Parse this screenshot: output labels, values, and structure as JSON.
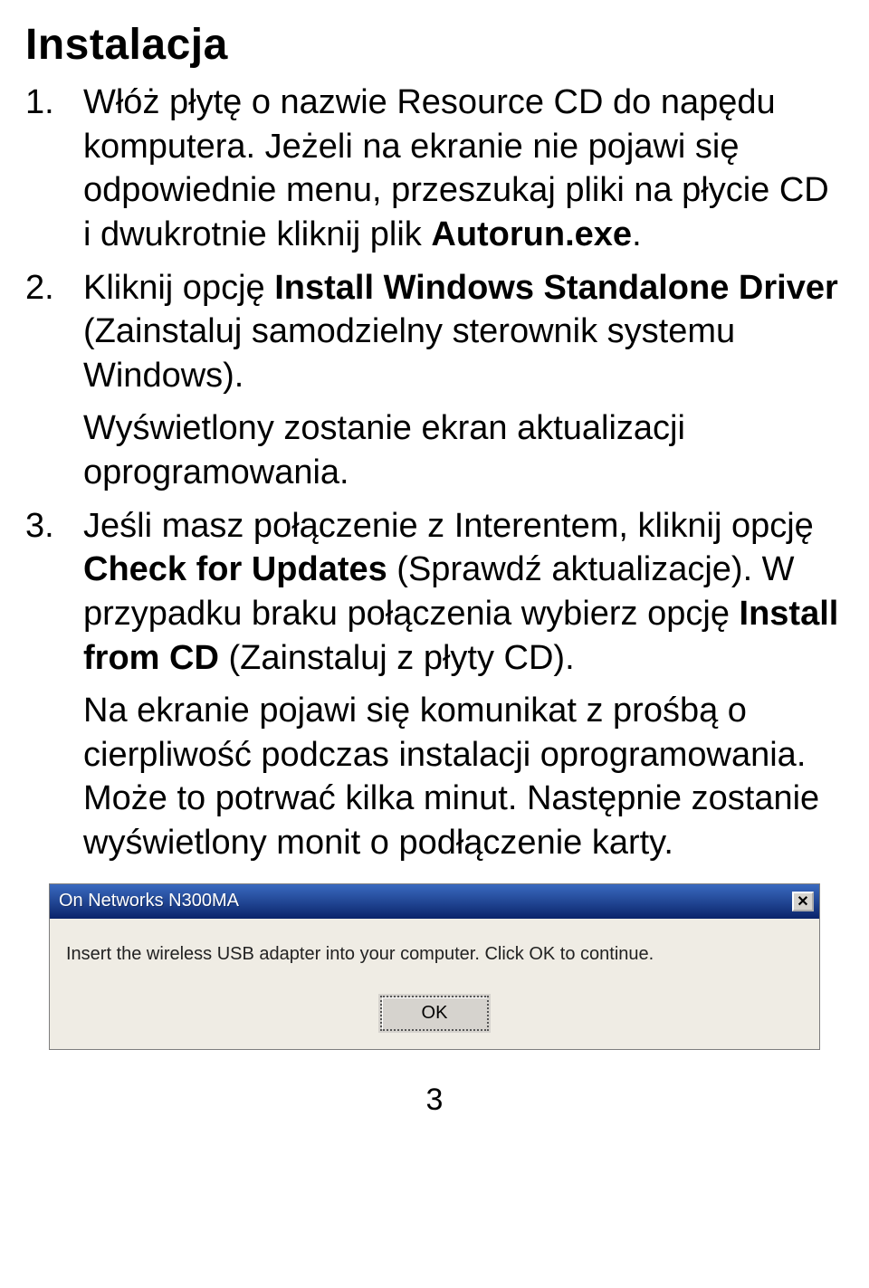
{
  "heading": "Instalacja",
  "steps": [
    {
      "num": "1.",
      "paragraphs": [
        {
          "segments": [
            {
              "text": "Włóż płytę o nazwie Resource CD do napędu komputera. Jeżeli na ekranie nie pojawi się odpowiednie menu, przeszukaj pliki na płycie CD i dwukrotnie kliknij plik "
            },
            {
              "text": "Autorun.exe",
              "bold": true
            },
            {
              "text": "."
            }
          ]
        }
      ]
    },
    {
      "num": "2.",
      "paragraphs": [
        {
          "segments": [
            {
              "text": "Kliknij opcję "
            },
            {
              "text": "Install Windows Standalone Driver",
              "bold": true
            },
            {
              "text": " (Zainstaluj samodzielny sterownik systemu Windows)."
            }
          ]
        },
        {
          "segments": [
            {
              "text": "Wyświetlony zostanie ekran aktualizacji oprogramowania."
            }
          ]
        }
      ]
    },
    {
      "num": "3.",
      "paragraphs": [
        {
          "segments": [
            {
              "text": "Jeśli masz połączenie z Interentem, kliknij opcję "
            },
            {
              "text": "Check for Updates",
              "bold": true
            },
            {
              "text": " (Sprawdź aktualizacje). W przypadku braku połączenia wybierz opcję "
            },
            {
              "text": "Install from CD",
              "bold": true
            },
            {
              "text": " (Zainstaluj z płyty CD)."
            }
          ]
        },
        {
          "segments": [
            {
              "text": "Na ekranie pojawi się komunikat z prośbą o cierpliwość podczas instalacji oprogramowania. Może to potrwać kilka minut. Następnie zostanie wyświetlony monit o podłączenie karty."
            }
          ]
        }
      ]
    }
  ],
  "dialog": {
    "title": "On Networks N300MA",
    "body": "Insert the wireless USB adapter into your computer. Click OK to continue.",
    "ok": "OK",
    "close": "✕"
  },
  "pageNumber": "3"
}
